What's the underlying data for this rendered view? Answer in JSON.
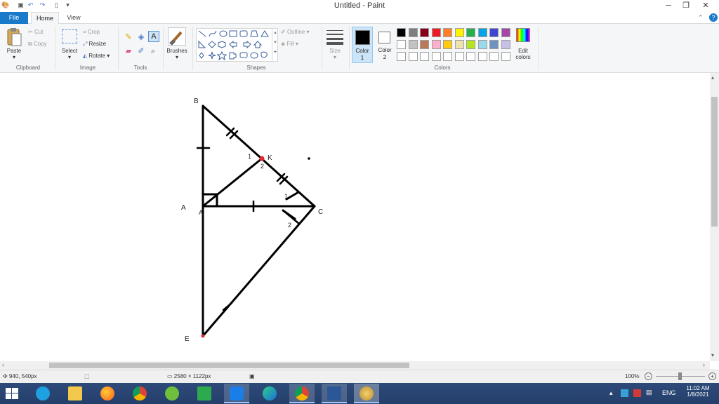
{
  "window": {
    "title": "Untitled - Paint",
    "controls": {
      "minimize": "─",
      "maximize": "❐",
      "close": "✕"
    }
  },
  "tabs": {
    "file": "File",
    "home": "Home",
    "view": "View",
    "help": "?"
  },
  "ribbon": {
    "clipboard": {
      "paste": "Paste",
      "cut": "Cut",
      "copy": "Copy",
      "group": "Clipboard"
    },
    "image": {
      "select": "Select",
      "crop": "Crop",
      "resize": "Resize",
      "rotate": "Rotate",
      "group": "Image"
    },
    "tools": {
      "group": "Tools"
    },
    "brushes": {
      "label": "Brushes"
    },
    "shapes": {
      "outline": "Outline",
      "fill": "Fill",
      "group": "Shapes"
    },
    "size": {
      "label": "Size"
    },
    "color1": {
      "label": "Color",
      "num": "1"
    },
    "color2": {
      "label": "Color",
      "num": "2"
    },
    "colors": {
      "group": "Colors",
      "edit_line1": "Edit",
      "edit_line2": "colors",
      "row1": [
        "#000000",
        "#7f7f7f",
        "#880015",
        "#ed1c24",
        "#ff7f27",
        "#fff200",
        "#22b14c",
        "#00a2e8",
        "#3f48cc",
        "#a349a4"
      ],
      "row2": [
        "#ffffff",
        "#c3c3c3",
        "#b97a57",
        "#ffaec9",
        "#ffc90e",
        "#efe4b0",
        "#b5e61d",
        "#99d9ea",
        "#7092be",
        "#c8bfe7"
      ],
      "row3": [
        "#ffffff",
        "#ffffff",
        "#ffffff",
        "#ffffff",
        "#ffffff",
        "#ffffff",
        "#ffffff",
        "#ffffff",
        "#ffffff",
        "#ffffff"
      ]
    }
  },
  "drawing": {
    "labels": {
      "B": "B",
      "K": "K",
      "A": "A",
      "A_small": "A",
      "C": "C",
      "E": "E"
    },
    "angle_labels": {
      "k1": "1",
      "k2": "2",
      "c1": "1",
      "c2": "2"
    }
  },
  "status": {
    "cursor_pos": "940, 540px",
    "canvas_size": "2580 × 1122px",
    "zoom": "100%"
  },
  "taskbar": {
    "lang": "ENG",
    "time": "11:02 AM",
    "date": "1/8/2021"
  }
}
